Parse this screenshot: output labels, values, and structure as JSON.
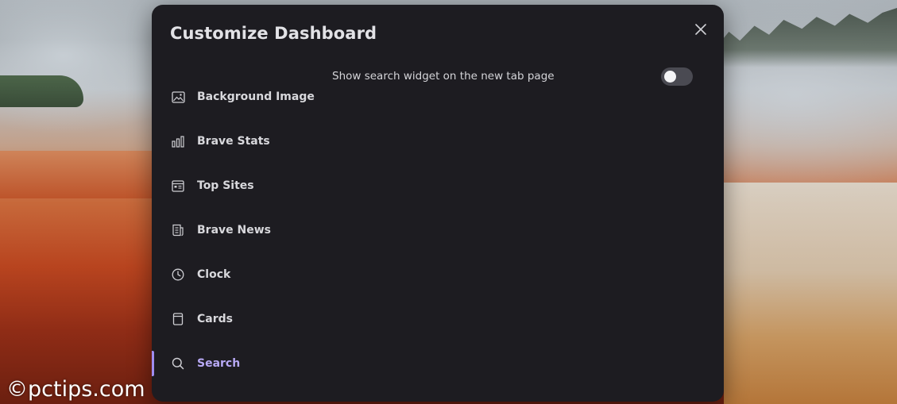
{
  "modal": {
    "title": "Customize Dashboard"
  },
  "nav": {
    "items": [
      {
        "label": "Background Image",
        "icon": "image-icon"
      },
      {
        "label": "Brave Stats",
        "icon": "bar-chart-icon"
      },
      {
        "label": "Top Sites",
        "icon": "top-sites-icon"
      },
      {
        "label": "Brave News",
        "icon": "news-icon"
      },
      {
        "label": "Clock",
        "icon": "clock-icon"
      },
      {
        "label": "Cards",
        "icon": "cards-icon"
      },
      {
        "label": "Search",
        "icon": "search-icon"
      }
    ],
    "active": "Search"
  },
  "settings": {
    "search_widget_label": "Show search widget on the new tab page",
    "search_widget_enabled": false
  },
  "watermark": "©pctips.com",
  "colors": {
    "modal_bg": "#1d1c21",
    "accent": "#b8a9f5",
    "text": "#d8d8dc"
  }
}
